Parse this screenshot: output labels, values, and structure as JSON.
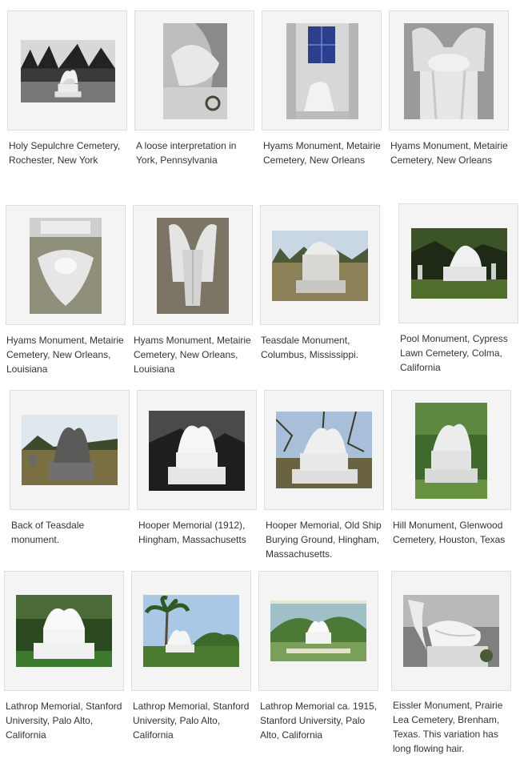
{
  "gallery": {
    "items": [
      {
        "caption": "Holy Sepulchre Cemetery, Rochester, New York",
        "image": "statue-photo-bw"
      },
      {
        "caption": "A loose interpretation in York, Pennsylvania",
        "image": "statue-closeup-photo"
      },
      {
        "caption": "Hyams Monument, Metairie Cemetery, New Orleans",
        "image": "tomb-interior-photo"
      },
      {
        "caption": "Hyams Monument, Metairie Cemetery, New Orleans",
        "image": "statue-closeup-photo"
      },
      {
        "caption": "Hyams Monument, Metairie Cemetery, New Orleans, Louisiana",
        "image": "statue-overhead-photo"
      },
      {
        "caption": "Hyams Monument, Metairie Cemetery, New Orleans, Louisiana",
        "image": "statue-back-photo"
      },
      {
        "caption": "Teasdale Monument, Columbus, Mississippi.",
        "image": "statue-cemetery-photo"
      },
      {
        "caption": "Pool Monument, Cypress Lawn Cemetery, Colma, California",
        "image": "statue-cemetery-photo"
      },
      {
        "caption": "Back of Teasdale monument.",
        "image": "statue-back-photo"
      },
      {
        "caption": "Hooper Memorial (1912), Hingham, Massachusetts",
        "image": "statue-photo-bw"
      },
      {
        "caption": "Hooper Memorial, Old Ship Burying Ground, Hingham, Massachusetts.",
        "image": "statue-cemetery-photo"
      },
      {
        "caption": "Hill Monument, Glenwood Cemetery, Houston, Texas",
        "image": "statue-cemetery-photo"
      },
      {
        "caption": "Lathrop Memorial, Stanford University, Palo Alto, California",
        "image": "statue-garden-photo"
      },
      {
        "caption": "Lathrop Memorial, Stanford University, Palo Alto, California",
        "image": "statue-garden-photo"
      },
      {
        "caption": "Lathrop Memorial ca. 1915, Stanford University, Palo Alto, California",
        "image": "postcard-photo"
      },
      {
        "caption": "Eissler Monument, Prairie Lea Cemetery, Brenham, Texas. This variation has long flowing hair.",
        "image": "statue-closeup-photo"
      }
    ]
  }
}
